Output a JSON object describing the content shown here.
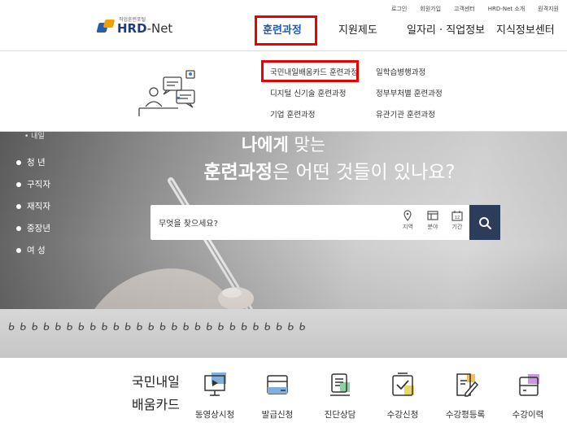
{
  "util_links": [
    "로그인",
    "회원가입",
    "고객센터",
    "HRD-Net 소개",
    "원격지원"
  ],
  "logo": {
    "sub": "직업훈련포털",
    "main_bold": "HRD",
    "main_rest": "-Net"
  },
  "gnb": [
    {
      "label": "훈련과정",
      "active": true
    },
    {
      "label": "지원제도",
      "active": false
    },
    {
      "label": "일자리 · 직업정보",
      "active": false
    },
    {
      "label": "지식정보센터",
      "active": false
    }
  ],
  "dropdown": {
    "col1": [
      "국민내일배움카드 훈련과정",
      "디지털 신기술 훈련과정",
      "기업 훈련과정"
    ],
    "col2": [
      "일학습병행과정",
      "정부부처별 훈련과정",
      "유관기관 훈련과정"
    ]
  },
  "hero": {
    "title1_bold": "나에게",
    "title1_rest": " 맞는",
    "title2_bold": "훈련과정",
    "title2_rest": "은 어떤 것들이 있나요?",
    "sidebar_partial": "• 내일",
    "sidebar": [
      "청 년",
      "구직자",
      "재직자",
      "중장년",
      "여 성"
    ],
    "search_placeholder": "무엇을 찾으세요?",
    "search_options": [
      {
        "icon": "location-pin-icon",
        "label": "지역"
      },
      {
        "icon": "category-icon",
        "label": "분야"
      },
      {
        "icon": "calendar-icon",
        "label": "기간"
      }
    ],
    "spiral_text": "ᑲ ᑲ ᑲ ᑲ ᑲ ᑲ ᑲ ᑲ ᑲ ᑲ ᑲ ᑲ ᑲ ᑲ ᑲ ᑲ ᑲ ᑲ ᑲ ᑲ ᑲ ᑲ ᑲ ᑲ ᑲ ᑲ"
  },
  "quick": {
    "card_line1": "국민내일",
    "card_line2": "배움카드",
    "items": [
      {
        "icon": "monitor-play-icon",
        "label": "동영상시청",
        "accent": "#7fb1e0"
      },
      {
        "icon": "card-issue-icon",
        "label": "발급신청",
        "accent": "#7fb1e0"
      },
      {
        "icon": "consult-icon",
        "label": "진단상담",
        "accent": "#8fd0a0"
      },
      {
        "icon": "checkbox-apply-icon",
        "label": "수강신청",
        "accent": "#e8d86a"
      },
      {
        "icon": "review-write-icon",
        "label": "수강평등록",
        "accent": "#f0c060"
      },
      {
        "icon": "history-card-icon",
        "label": "수강이력",
        "accent": "#c79ae0"
      }
    ]
  },
  "colors": {
    "accent": "#1f5bb5",
    "highlight_box": "#ee0000",
    "search_button": "#2d3c5a"
  }
}
